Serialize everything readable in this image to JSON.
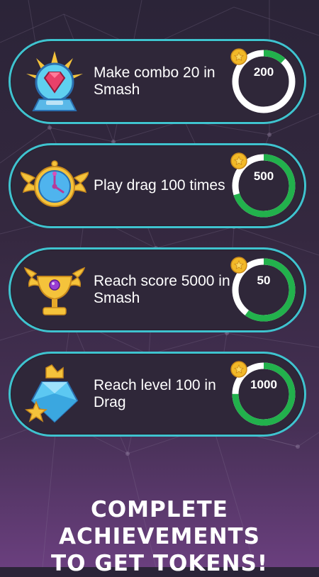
{
  "achievements": [
    {
      "title": "Make combo 20 in Smash",
      "reward": "200",
      "progress": 0.12,
      "icon": "gem-trophy-icon"
    },
    {
      "title": "Play drag 100 times",
      "reward": "500",
      "progress": 0.7,
      "icon": "winged-clock-icon"
    },
    {
      "title": "Reach score 5000 in Smash",
      "reward": "50",
      "progress": 0.6,
      "icon": "winged-cup-icon"
    },
    {
      "title": "Reach level 100 in Drag",
      "reward": "1000",
      "progress": 0.75,
      "icon": "crystal-star-icon"
    }
  ],
  "footer": {
    "line1": "COMPLETE ACHIEVEMENTS",
    "line2": "TO GET TOKENS!"
  },
  "colors": {
    "border": "#3fc3cf",
    "progress": "#22b14c",
    "track": "#ffffff",
    "coin": "#f2b928"
  }
}
